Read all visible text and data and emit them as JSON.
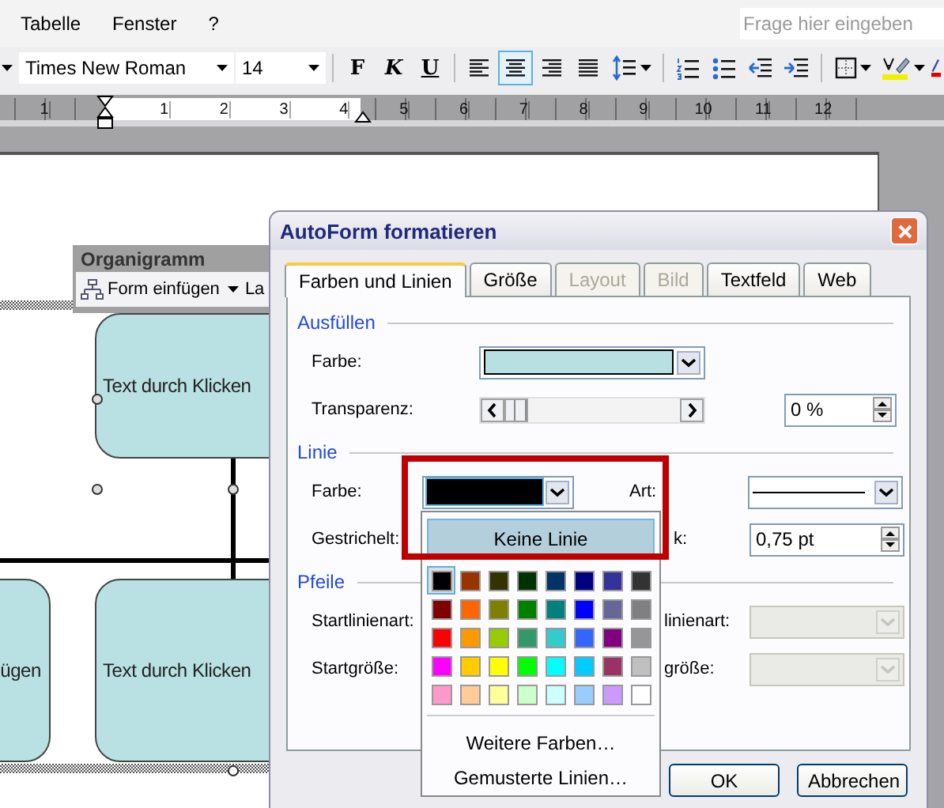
{
  "menu": [
    {
      "label": "Tabelle"
    },
    {
      "label": "Fenster"
    },
    {
      "label": "?"
    }
  ],
  "help_search": {
    "placeholder": "Frage hier eingeben"
  },
  "toolbar": {
    "font": "Times New Roman",
    "size": "14",
    "buttons": [
      {
        "kind": "bold",
        "label": "F",
        "selected": false
      },
      {
        "kind": "italic",
        "label": "K",
        "selected": false
      },
      {
        "kind": "underline",
        "label": "U",
        "selected": false
      },
      {
        "kind": "align-left",
        "selected": false
      },
      {
        "kind": "align-center",
        "selected": true
      },
      {
        "kind": "align-right",
        "selected": false
      },
      {
        "kind": "justify",
        "selected": false
      },
      {
        "kind": "line-spacing",
        "selected": false
      },
      {
        "kind": "numbering",
        "selected": false
      },
      {
        "kind": "bullets",
        "selected": false
      },
      {
        "kind": "outdent",
        "selected": false
      },
      {
        "kind": "indent",
        "selected": false
      },
      {
        "kind": "borders",
        "selected": false
      },
      {
        "kind": "highlight",
        "selected": false
      },
      {
        "kind": "font-color",
        "selected": false
      }
    ]
  },
  "ruler": {
    "labels": [
      "1",
      "1",
      "2",
      "3",
      "4",
      "5",
      "6",
      "7",
      "8",
      "9",
      "10",
      "11",
      "12"
    ]
  },
  "org_toolbar": {
    "title": "Organigramm",
    "items": [
      {
        "kind": "insert-shape",
        "label": "Form einfügen"
      },
      {
        "kind": "layout",
        "label": "La"
      }
    ]
  },
  "diagram": {
    "shapes": [
      {
        "text": "Text durch Klicken"
      },
      {
        "text": "ügen"
      },
      {
        "text": "Text durch Klicken"
      }
    ]
  },
  "dialog": {
    "title": "AutoForm formatieren",
    "tabs": [
      {
        "label": "Farben und Linien",
        "selected": true,
        "disabled": false
      },
      {
        "label": "Größe",
        "selected": false,
        "disabled": false
      },
      {
        "label": "Layout",
        "selected": false,
        "disabled": true
      },
      {
        "label": "Bild",
        "selected": false,
        "disabled": true
      },
      {
        "label": "Textfeld",
        "selected": false,
        "disabled": false
      },
      {
        "label": "Web",
        "selected": false,
        "disabled": false
      }
    ],
    "sections": [
      {
        "title": "Ausfüllen",
        "rows": [
          {
            "kind": "fill",
            "label": "Farbe:",
            "color": "#b8dfe1"
          },
          {
            "kind": "transparency",
            "label": "Transparenz:",
            "level": 0,
            "value": "0 %"
          }
        ]
      },
      {
        "title": "Linie",
        "rows": [
          {
            "kind": "line-color",
            "label": "Farbe:",
            "color": "#000000",
            "label2": "Art:"
          },
          {
            "kind": "dash",
            "label": "Gestrichelt:",
            "label2": "k:",
            "value": "0,75 pt"
          }
        ]
      },
      {
        "title": "Pfeile",
        "rows": [
          {
            "kind": "arrow",
            "label": "Startlinienart:",
            "label2": "linienart:",
            "disabled": true
          },
          {
            "kind": "arrow",
            "label": "Startgröße:",
            "label2": "größe:",
            "disabled": true
          }
        ]
      }
    ],
    "buttons": [
      "OK",
      "Abbrechen"
    ],
    "color_popup": {
      "no_line": {
        "label": "Keine Linie",
        "highlighted": true
      },
      "swatches": [
        {
          "color": "#000000",
          "selected": true
        },
        {
          "color": "#993300",
          "selected": false
        },
        {
          "color": "#333300",
          "selected": false
        },
        {
          "color": "#003300",
          "selected": false
        },
        {
          "color": "#003366",
          "selected": false
        },
        {
          "color": "#000080",
          "selected": false
        },
        {
          "color": "#333399",
          "selected": false
        },
        {
          "color": "#333333",
          "selected": false
        },
        {
          "color": "#800000",
          "selected": false
        },
        {
          "color": "#ff6600",
          "selected": false
        },
        {
          "color": "#808000",
          "selected": false
        },
        {
          "color": "#008000",
          "selected": false
        },
        {
          "color": "#008080",
          "selected": false
        },
        {
          "color": "#0000ff",
          "selected": false
        },
        {
          "color": "#666699",
          "selected": false
        },
        {
          "color": "#808080",
          "selected": false
        },
        {
          "color": "#ff0000",
          "selected": false
        },
        {
          "color": "#ff9900",
          "selected": false
        },
        {
          "color": "#99cc00",
          "selected": false
        },
        {
          "color": "#339966",
          "selected": false
        },
        {
          "color": "#33cccc",
          "selected": false
        },
        {
          "color": "#3366ff",
          "selected": false
        },
        {
          "color": "#800080",
          "selected": false
        },
        {
          "color": "#969696",
          "selected": false
        },
        {
          "color": "#ff00ff",
          "selected": false
        },
        {
          "color": "#ffcc00",
          "selected": false
        },
        {
          "color": "#ffff00",
          "selected": false
        },
        {
          "color": "#00ff00",
          "selected": false
        },
        {
          "color": "#00ffff",
          "selected": false
        },
        {
          "color": "#00ccff",
          "selected": false
        },
        {
          "color": "#993366",
          "selected": false
        },
        {
          "color": "#c0c0c0",
          "selected": false
        },
        {
          "color": "#ff99cc",
          "selected": false
        },
        {
          "color": "#ffcc99",
          "selected": false
        },
        {
          "color": "#ffff99",
          "selected": false
        },
        {
          "color": "#ccffcc",
          "selected": false
        },
        {
          "color": "#ccffff",
          "selected": false
        },
        {
          "color": "#99ccff",
          "selected": false
        },
        {
          "color": "#cc99ff",
          "selected": false
        },
        {
          "color": "#ffffff",
          "selected": false
        }
      ],
      "links": [
        "Weitere Farben…",
        "Gemusterte Linien…"
      ]
    }
  }
}
